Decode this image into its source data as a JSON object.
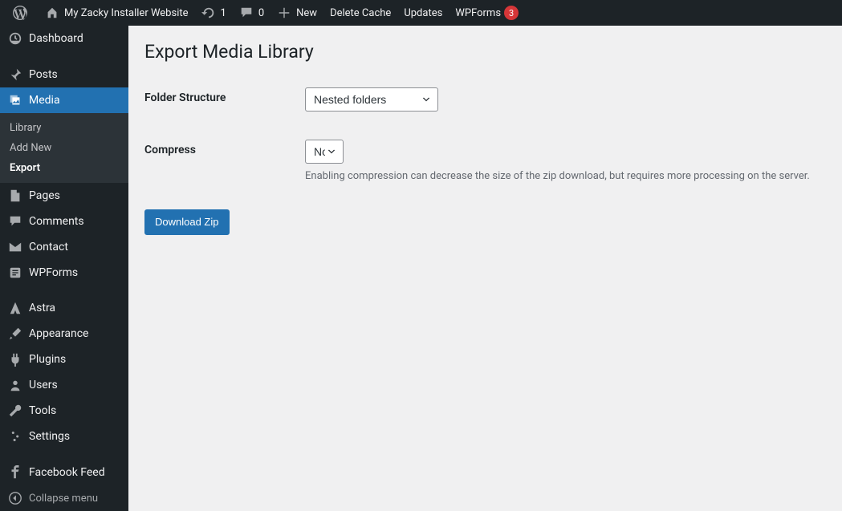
{
  "adminbar": {
    "site_name": "My Zacky Installer Website",
    "updates_count": "1",
    "comments_count": "0",
    "new_label": "New",
    "delete_cache": "Delete Cache",
    "updates_label": "Updates",
    "wpforms_label": "WPForms",
    "wpforms_badge": "3"
  },
  "menu": {
    "dashboard": "Dashboard",
    "posts": "Posts",
    "media": "Media",
    "media_sub": {
      "library": "Library",
      "add_new": "Add New",
      "export": "Export"
    },
    "pages": "Pages",
    "comments": "Comments",
    "contact": "Contact",
    "wpforms": "WPForms",
    "astra": "Astra",
    "appearance": "Appearance",
    "plugins": "Plugins",
    "users": "Users",
    "tools": "Tools",
    "settings": "Settings",
    "facebook_feed": "Facebook Feed",
    "collapse": "Collapse menu"
  },
  "page": {
    "title": "Export Media Library",
    "folder_structure_label": "Folder Structure",
    "folder_structure_value": "Nested folders",
    "compress_label": "Compress",
    "compress_value": "No",
    "compress_description": "Enabling compression can decrease the size of the zip download, but requires more processing on the server.",
    "download_button": "Download Zip"
  }
}
